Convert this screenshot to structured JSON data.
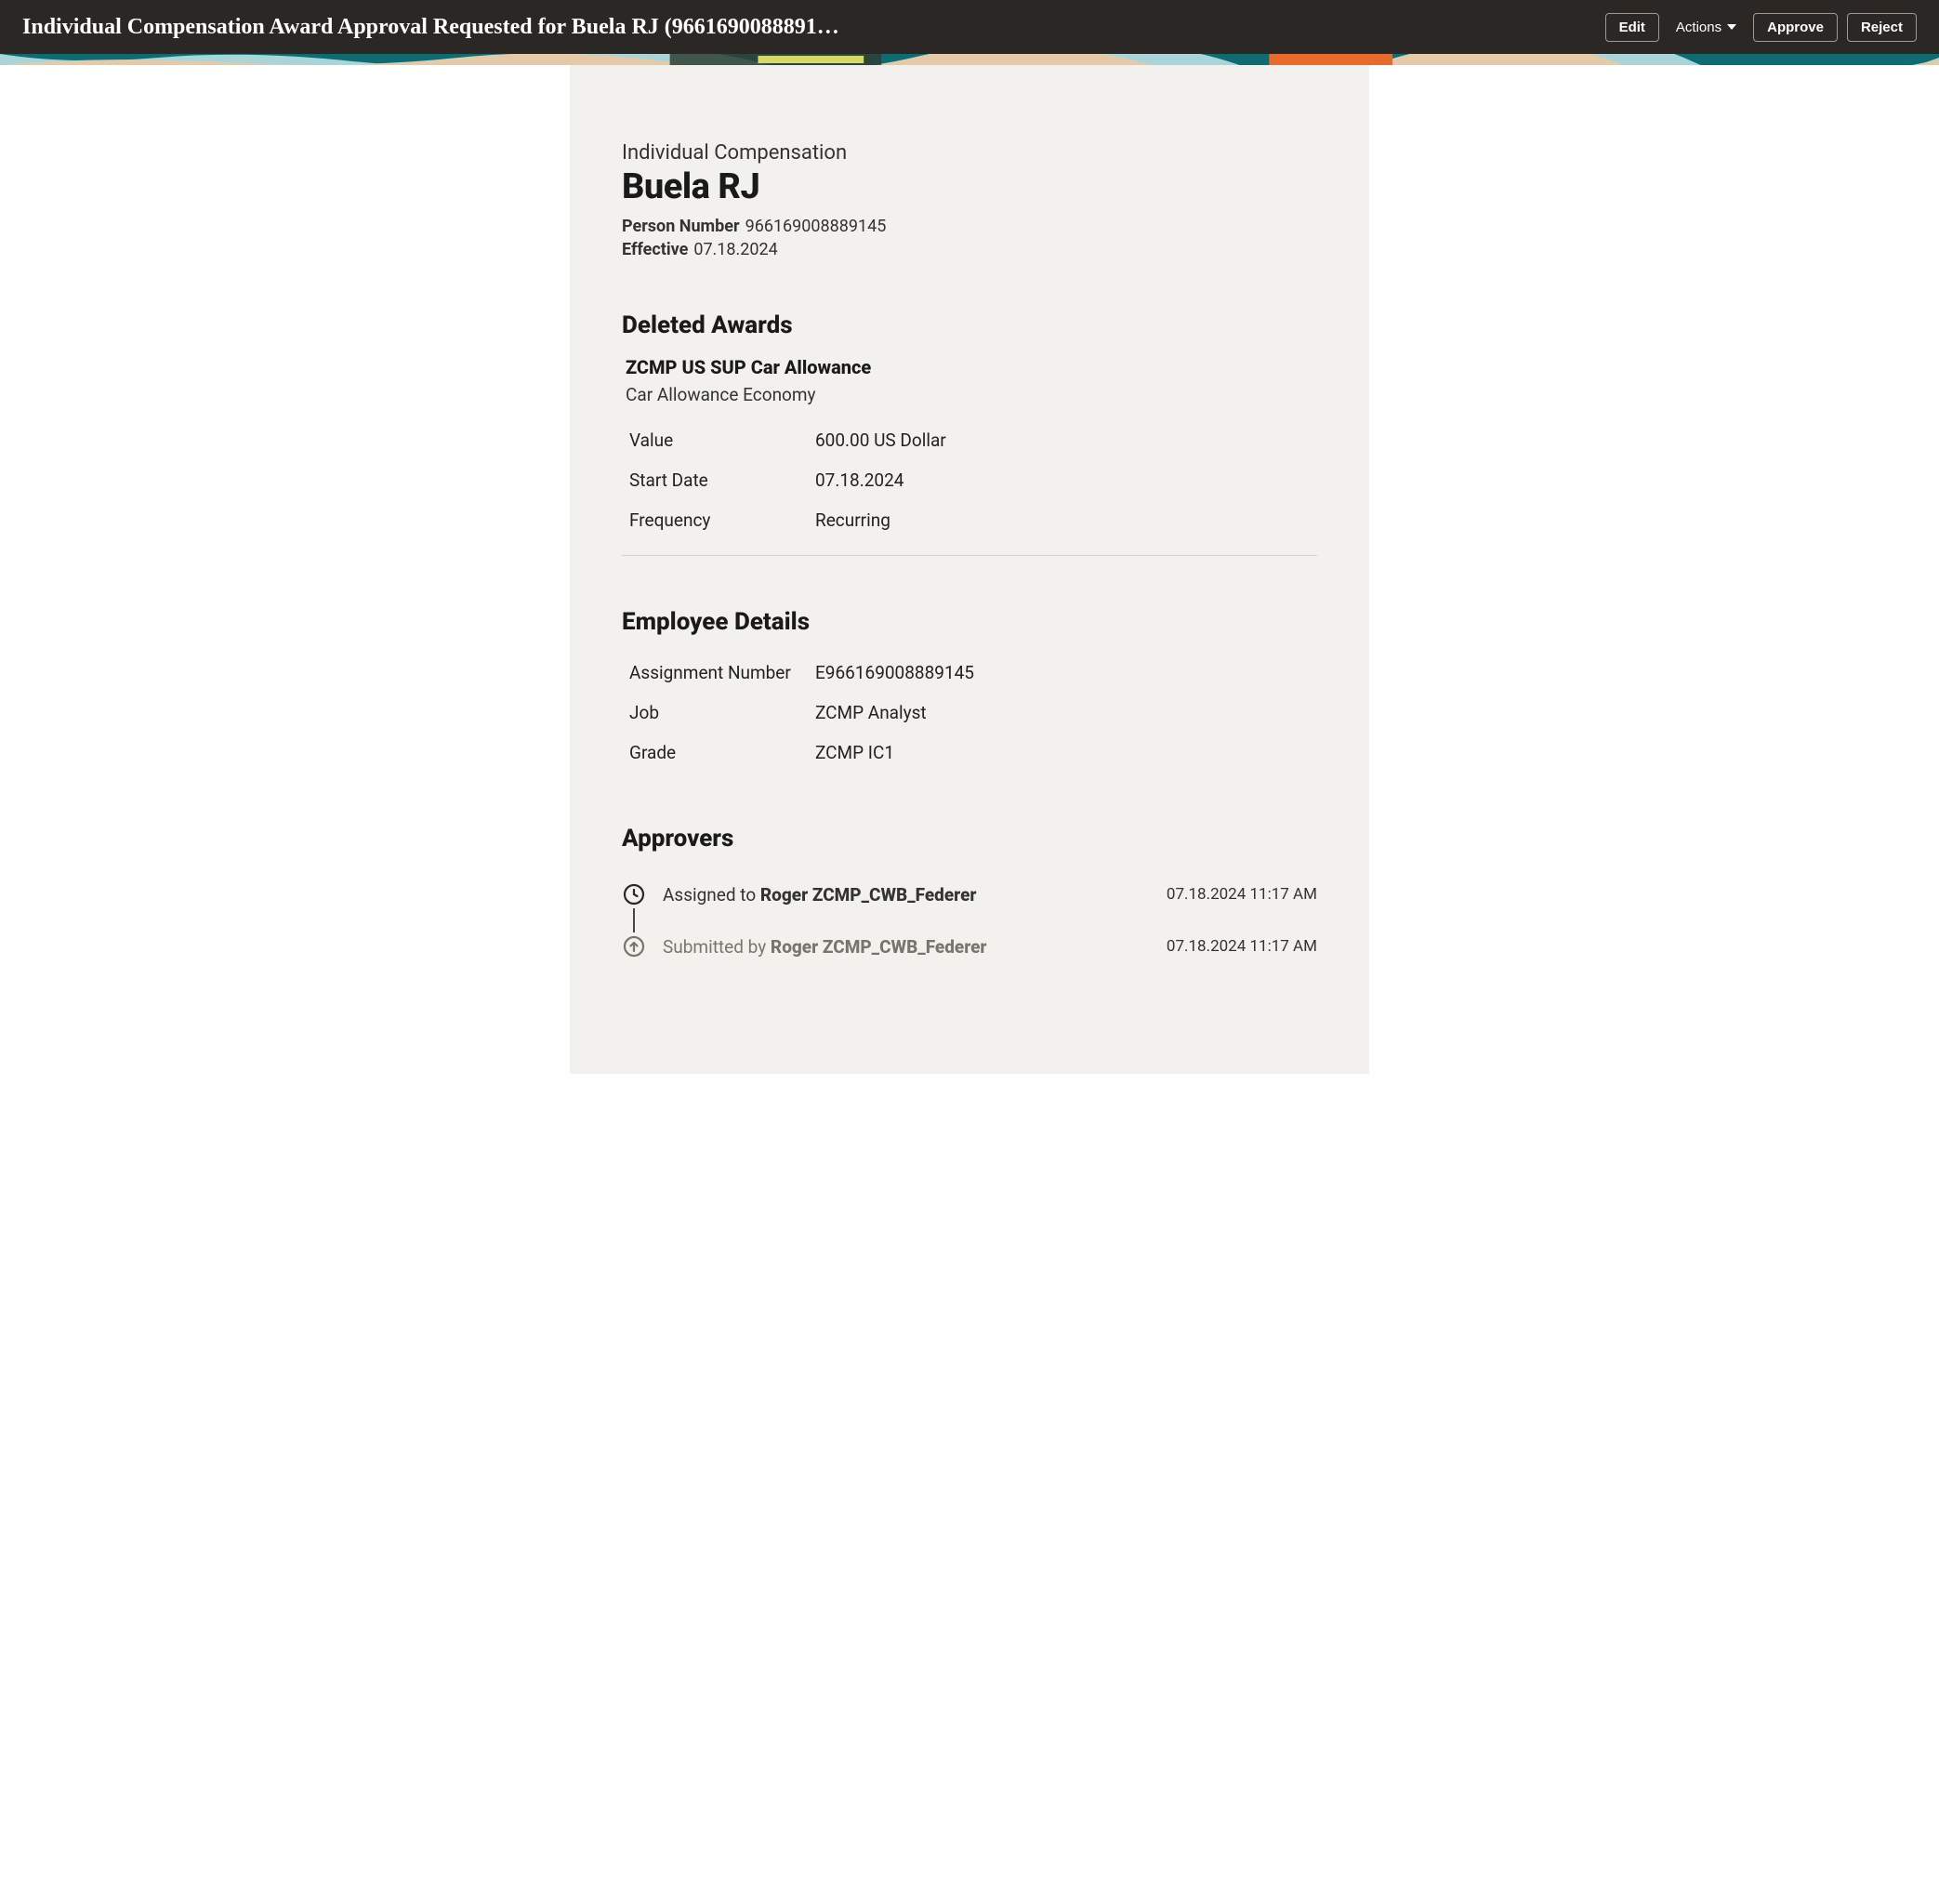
{
  "topbar": {
    "title": "Individual Compensation Award Approval Requested for Buela RJ (9661690088891…",
    "edit": "Edit",
    "actions": "Actions",
    "approve": "Approve",
    "reject": "Reject"
  },
  "header": {
    "section": "Individual Compensation",
    "name": "Buela RJ",
    "person_number_label": "Person Number",
    "person_number": "966169008889145",
    "effective_label": "Effective",
    "effective": "07.18.2024"
  },
  "deleted_awards": {
    "heading": "Deleted Awards",
    "award_name": "ZCMP US SUP Car Allowance",
    "award_sub": "Car Allowance Economy",
    "rows": {
      "value_label": "Value",
      "value": "600.00 US Dollar",
      "start_label": "Start Date",
      "start": "07.18.2024",
      "freq_label": "Frequency",
      "freq": "Recurring"
    }
  },
  "employee": {
    "heading": "Employee Details",
    "rows": {
      "assign_label": "Assignment Number",
      "assign": "E966169008889145",
      "job_label": "Job",
      "job": "ZCMP Analyst",
      "grade_label": "Grade",
      "grade": "ZCMP IC1"
    }
  },
  "approvers": {
    "heading": "Approvers",
    "assigned_prefix": "Assigned to ",
    "assigned_name": "Roger ZCMP_CWB_Federer",
    "assigned_date": "07.18.2024 11:17 AM",
    "submitted_prefix": "Submitted by ",
    "submitted_name": "Roger ZCMP_CWB_Federer",
    "submitted_date": "07.18.2024 11:17 AM"
  }
}
